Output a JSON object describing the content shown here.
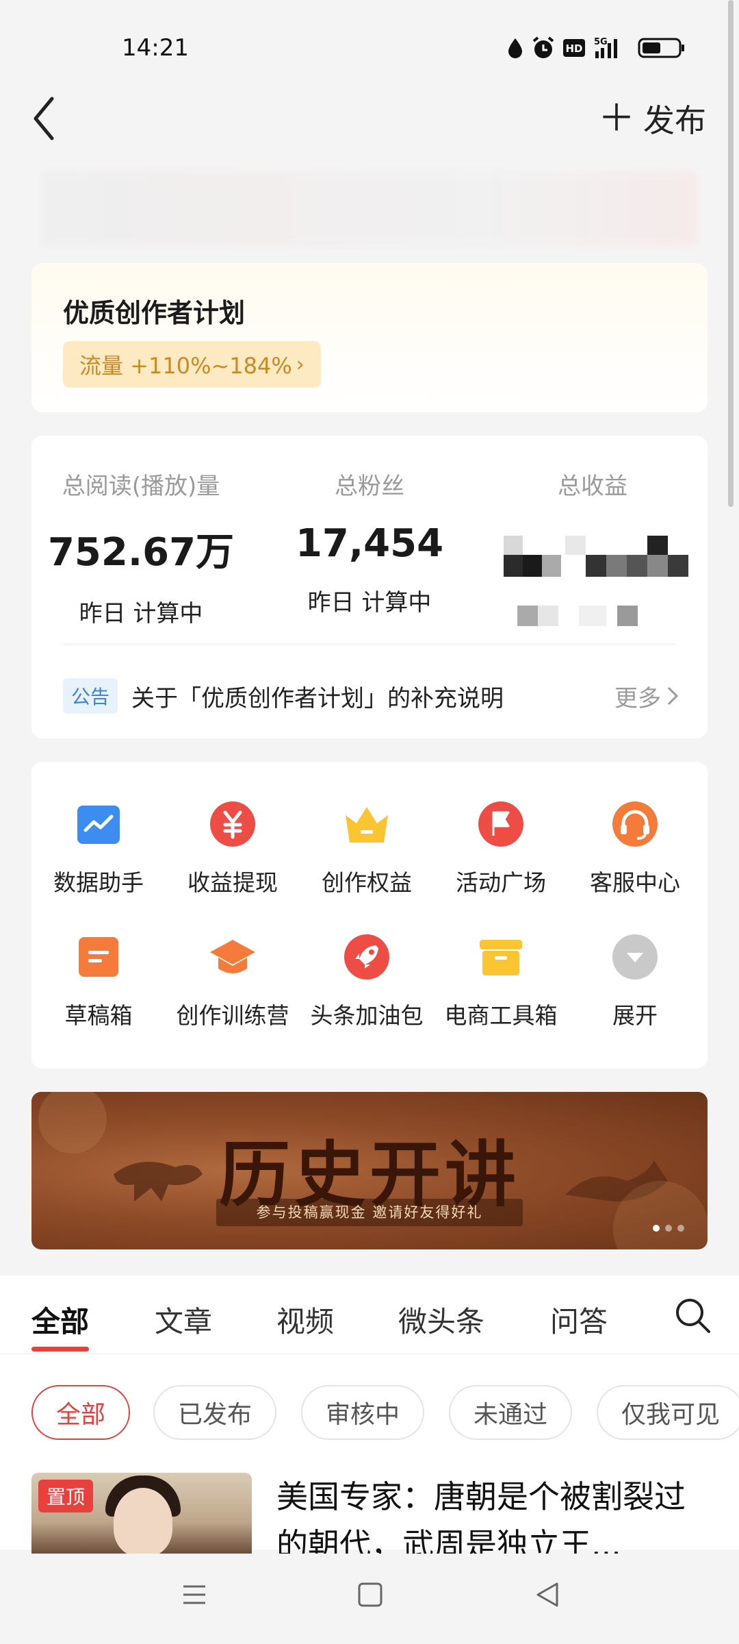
{
  "status_bar": {
    "time": "14:21",
    "icons": [
      "drop-icon",
      "alarm-icon",
      "hd-icon",
      "5g-signal-icon",
      "battery-icon"
    ],
    "network": "5G",
    "hd": "HD"
  },
  "nav": {
    "publish_label": "发布"
  },
  "plan": {
    "title": "优质创作者计划",
    "tag": "流量 +110%~184%"
  },
  "stats": {
    "read": {
      "label": "总阅读(播放)量",
      "value": "752.67万",
      "sub": "昨日 计算中"
    },
    "fans": {
      "label": "总粉丝",
      "value": "17,454",
      "sub": "昨日 计算中"
    },
    "earnings": {
      "label": "总收益"
    }
  },
  "notice": {
    "badge": "公告",
    "text": "关于「优质创作者计划」的补充说明",
    "more": "更多"
  },
  "tools": [
    {
      "label": "数据助手",
      "icon": "chart-icon"
    },
    {
      "label": "收益提现",
      "icon": "yuan-icon"
    },
    {
      "label": "创作权益",
      "icon": "crown-icon"
    },
    {
      "label": "活动广场",
      "icon": "flag-icon"
    },
    {
      "label": "客服中心",
      "icon": "headset-icon"
    },
    {
      "label": "草稿箱",
      "icon": "draft-icon"
    },
    {
      "label": "创作训练营",
      "icon": "graduation-cap-icon"
    },
    {
      "label": "头条加油包",
      "icon": "rocket-icon"
    },
    {
      "label": "电商工具箱",
      "icon": "box-icon"
    },
    {
      "label": "展开",
      "icon": "chevron-down-icon"
    }
  ],
  "promo": {
    "title": "历史开讲",
    "subtitle": "参与投稿赢现金 邀请好友得好礼"
  },
  "content_tabs": [
    "全部",
    "文章",
    "视频",
    "微头条",
    "问答"
  ],
  "filter_chips": [
    "全部",
    "已发布",
    "审核中",
    "未通过",
    "仅我可见"
  ],
  "article": {
    "badge": "置顶",
    "title": "美国专家：唐朝是个被割裂过的朝代，武周是独立王..."
  },
  "colors": {
    "accent": "#e8403c",
    "plan_tag_bg": "#fde9c2",
    "plan_tag_text": "#c98a26",
    "notice_badge": "#3b84d8"
  }
}
